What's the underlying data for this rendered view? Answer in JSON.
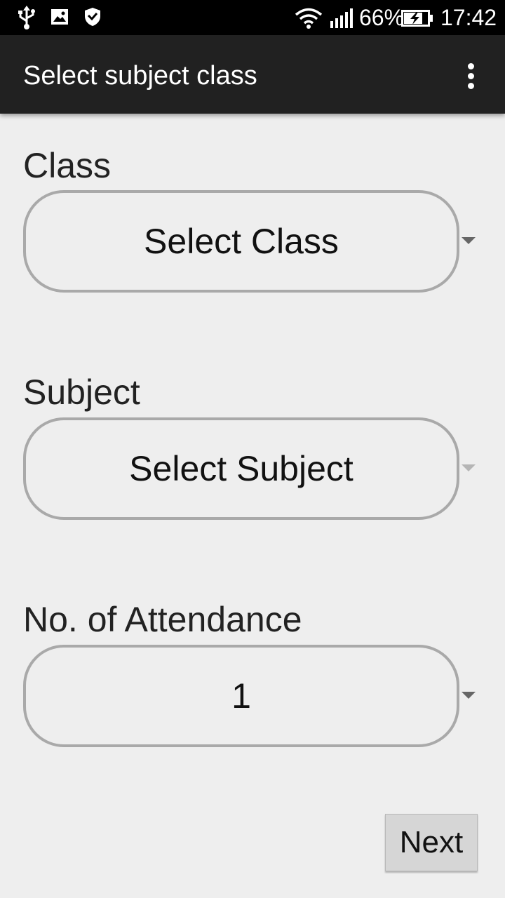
{
  "status_bar": {
    "battery_percent": "66%",
    "time": "17:42",
    "icons": [
      "usb-icon",
      "image-icon",
      "shield-icon",
      "wifi-icon",
      "signal-icon",
      "battery-charging-icon"
    ]
  },
  "app_bar": {
    "title": "Select subject class",
    "menu_icon": "overflow-menu-icon"
  },
  "form": {
    "class": {
      "label": "Class",
      "value": "Select Class"
    },
    "subject": {
      "label": "Subject",
      "value": "Select Subject"
    },
    "attendance": {
      "label": "No. of Attendance",
      "value": "1"
    }
  },
  "actions": {
    "next_label": "Next"
  },
  "colors": {
    "status_bar": "#000000",
    "app_bar": "#212121",
    "background": "#eeeeee",
    "spinner_border": "#a9a9a9",
    "button": "#d6d6d6"
  }
}
